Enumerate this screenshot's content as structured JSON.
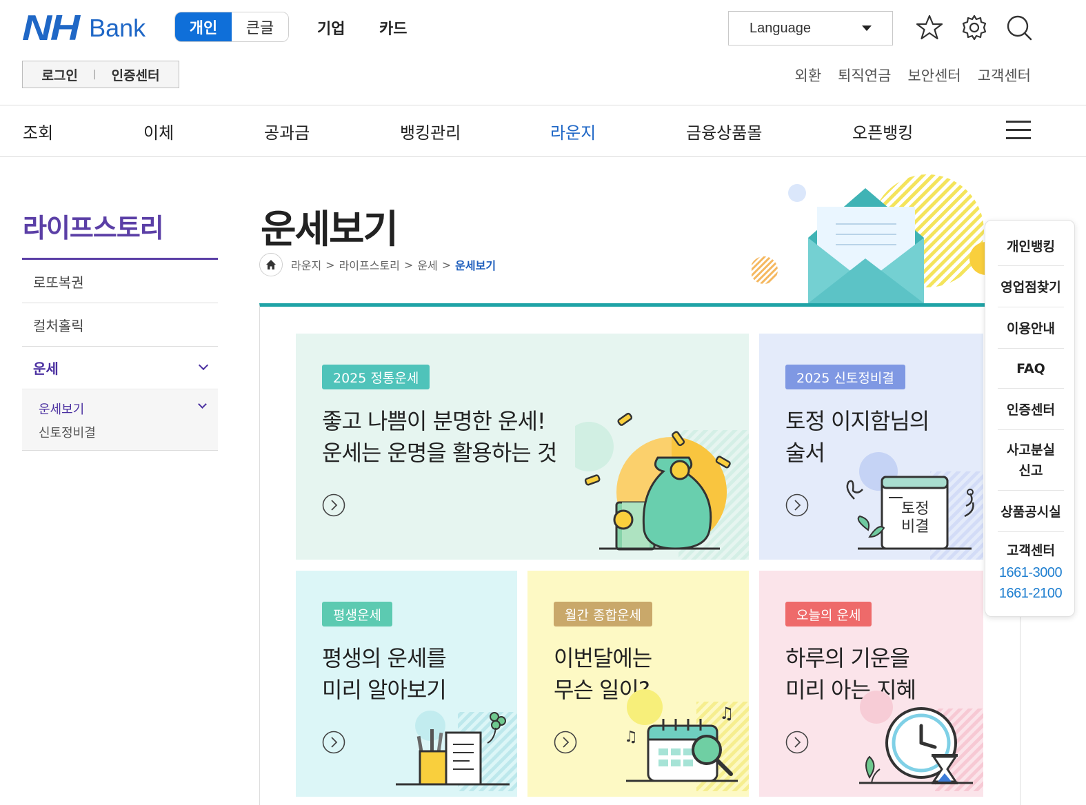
{
  "logo": {
    "nh": "NH",
    "bank": "Bank"
  },
  "mode": {
    "personal": "개인",
    "large_text": "큰글"
  },
  "top_menu": {
    "business": "기업",
    "card": "카드"
  },
  "language": {
    "label": "Language"
  },
  "login": {
    "login": "로그인",
    "separator": "|",
    "cert_center": "인증센터"
  },
  "util_links": [
    "외환",
    "퇴직연금",
    "보안센터",
    "고객센터"
  ],
  "gnb": [
    "조회",
    "이체",
    "공과금",
    "뱅킹관리",
    "라운지",
    "금융상품몰",
    "오픈뱅킹"
  ],
  "lnb": {
    "title": "라이프스토리",
    "items": [
      "로또복권",
      "컬처홀릭",
      "운세"
    ],
    "sub_items": [
      "운세보기",
      "신토정비결"
    ]
  },
  "page": {
    "title": "운세보기"
  },
  "breadcrumb": [
    "라운지",
    "라이프스토리",
    "운세",
    "운세보기"
  ],
  "cards": [
    {
      "tag": "2025 정통운세",
      "text": "좋고 나쁨이 분명한 운세!\n운세는 운명을 활용하는 것"
    },
    {
      "tag": "2025 신토정비결",
      "text": "토정 이지함님의\n술서",
      "art_label": "토정\n비결"
    },
    {
      "tag": "평생운세",
      "text": "평생의 운세를\n미리 알아보기"
    },
    {
      "tag": "월간 종합운세",
      "text": "이번달에는\n무슨 일이?"
    },
    {
      "tag": "오늘의 운세",
      "text": "하루의 기운을\n미리 아는 지혜"
    }
  ],
  "quick_menu": {
    "items": [
      "개인뱅킹",
      "영업점찾기",
      "이용안내",
      "FAQ",
      "인증센터",
      "사고분실\n신고",
      "상품공시실",
      "고객센터"
    ],
    "phones": [
      "1661-3000",
      "1661-2100"
    ]
  },
  "colors": {
    "brand_blue": "#1f67c6",
    "lnb_purple": "#5b3fa6",
    "content_teal": "#1fa3a6"
  }
}
